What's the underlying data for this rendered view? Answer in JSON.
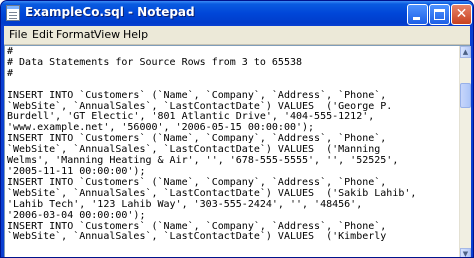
{
  "window": {
    "title": "ExampleCo.sql - Notepad",
    "icon": "notepad-icon",
    "controls": {
      "minimize": "minimize-icon",
      "maximize": "maximize-icon",
      "close": "close-icon",
      "close_glyph": "✕"
    }
  },
  "menu": [
    "File",
    "Edit",
    "Format",
    "View",
    "Help"
  ],
  "editor": {
    "content": "#\n# Data Statements for Source Rows from 3 to 65538\n#\n\nINSERT INTO `Customers` (`Name`, `Company`, `Address`, `Phone`,\n`WebSite`, `AnnualSales`, `LastContactDate`) VALUES  ('George P.\nBurdell', 'GT Electic', '801 Atlantic Drive', '404-555-1212',\n'www.example.net', '56000', '2006-05-15 00:00:00');\nINSERT INTO `Customers` (`Name`, `Company`, `Address`, `Phone`,\n`WebSite`, `AnnualSales`, `LastContactDate`) VALUES  ('Manning\nWelms', 'Manning Heating & Air', '', '678-555-5555', '', '52525',\n'2005-11-11 00:00:00');\nINSERT INTO `Customers` (`Name`, `Company`, `Address`, `Phone`,\n`WebSite`, `AnnualSales`, `LastContactDate`) VALUES  ('Sakib Lahib',\n'Lahib Tech', '123 Lahib Way', '303-555-2424', '', '48456',\n'2006-03-04 00:00:00');\nINSERT INTO `Customers` (`Name`, `Company`, `Address`, `Phone`,\n`WebSite`, `AnnualSales`, `LastContactDate`) VALUES  ('Kimberly"
  },
  "scrollbar": {
    "up_glyph": "▲",
    "down_glyph": "▼"
  }
}
